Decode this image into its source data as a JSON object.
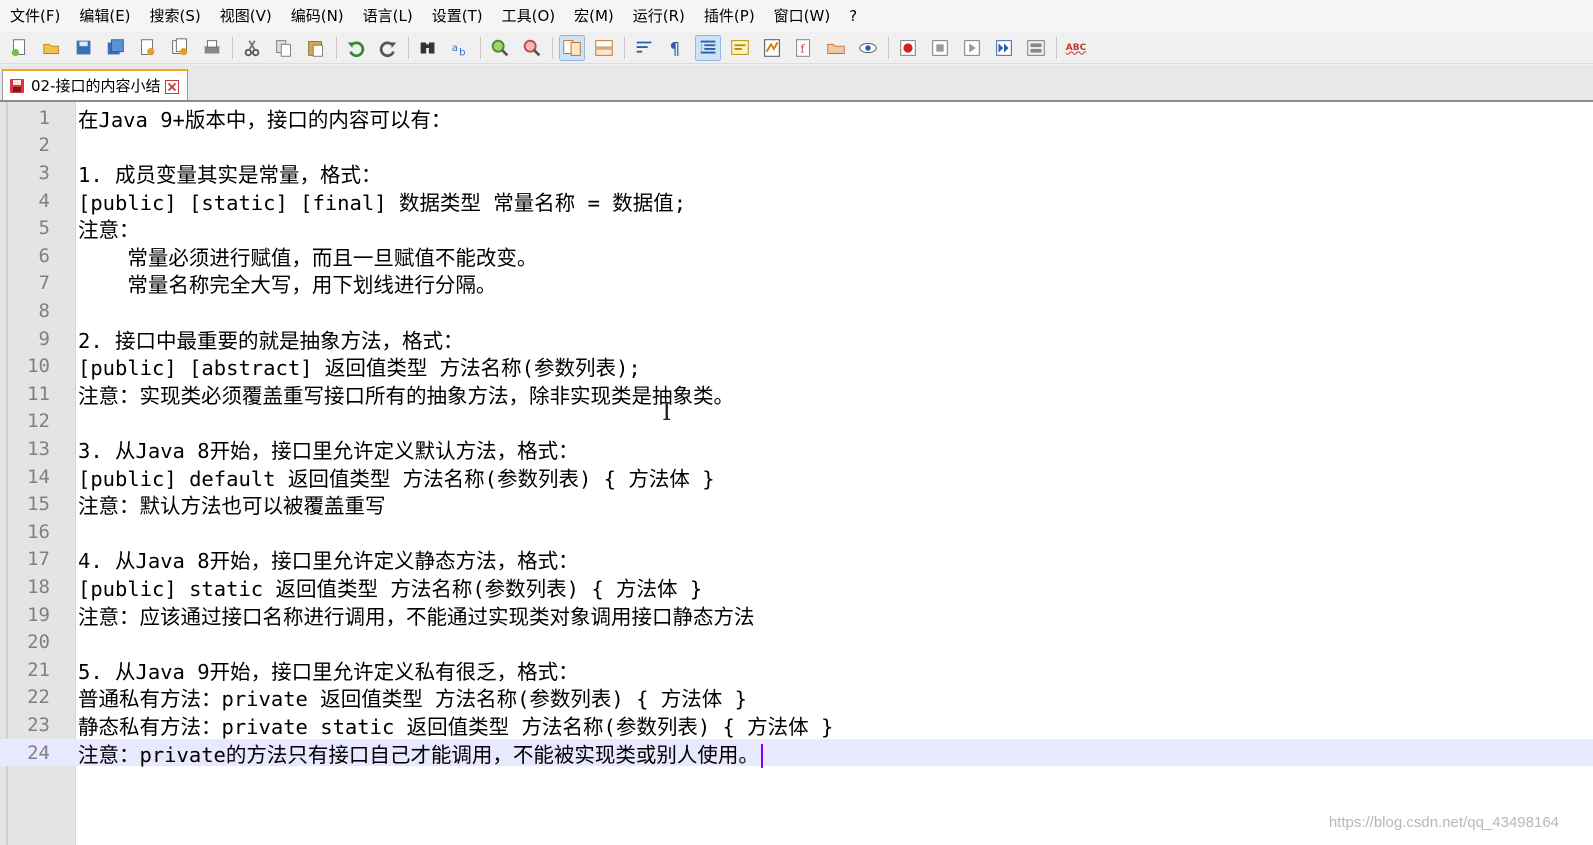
{
  "menu": [
    "文件(F)",
    "编辑(E)",
    "搜索(S)",
    "视图(V)",
    "编码(N)",
    "语言(L)",
    "设置(T)",
    "工具(O)",
    "宏(M)",
    "运行(R)",
    "插件(P)",
    "窗口(W)",
    "?"
  ],
  "toolbar": {
    "icons": [
      "new-file-icon",
      "open-file-icon",
      "save-icon",
      "save-all-icon",
      "close-icon",
      "close-all-icon",
      "print-icon",
      "cut-icon",
      "copy-icon",
      "paste-icon",
      "undo-icon",
      "redo-icon",
      "find-icon",
      "replace-icon",
      "zoom-in-icon",
      "zoom-out-icon",
      "sync-vertical-icon",
      "sync-horizontal-icon",
      "word-wrap-icon",
      "show-all-chars-icon",
      "indent-guide-icon",
      "udl-icon",
      "doc-map-icon",
      "function-list-icon",
      "folder-workspace-icon",
      "monitoring-icon",
      "record-macro-icon",
      "stop-macro-icon",
      "play-macro-icon",
      "run-macro-multiple-icon",
      "save-macro-icon",
      "spell-check-icon"
    ],
    "spell_label": "ABC"
  },
  "tab": {
    "title": "02-接口的内容小结"
  },
  "editor": {
    "lines": [
      "在Java 9+版本中，接口的内容可以有：",
      "",
      "1. 成员变量其实是常量，格式：",
      "[public] [static] [final] 数据类型 常量名称 = 数据值;",
      "注意：",
      "    常量必须进行赋值，而且一旦赋值不能改变。",
      "    常量名称完全大写，用下划线进行分隔。",
      "",
      "2. 接口中最重要的就是抽象方法，格式：",
      "[public] [abstract] 返回值类型 方法名称(参数列表);",
      "注意：实现类必须覆盖重写接口所有的抽象方法，除非实现类是抽象类。",
      "",
      "3. 从Java 8开始，接口里允许定义默认方法，格式：",
      "[public] default 返回值类型 方法名称(参数列表) { 方法体 }",
      "注意：默认方法也可以被覆盖重写",
      "",
      "4. 从Java 8开始，接口里允许定义静态方法，格式：",
      "[public] static 返回值类型 方法名称(参数列表) { 方法体 }",
      "注意：应该通过接口名称进行调用，不能通过实现类对象调用接口静态方法",
      "",
      "5. 从Java 9开始，接口里允许定义私有很乏，格式：",
      "普通私有方法：private 返回值类型 方法名称(参数列表) { 方法体 }",
      "静态私有方法：private static 返回值类型 方法名称(参数列表) { 方法体 }",
      "注意：private的方法只有接口自己才能调用，不能被实现类或别人使用。"
    ],
    "current_line": 24
  },
  "watermark": "https://blog.csdn.net/qq_43498164",
  "colors": {
    "current_line_bg": "#e8e8ff",
    "caret": "#8000ff",
    "tab_accent": "#f5a623"
  }
}
